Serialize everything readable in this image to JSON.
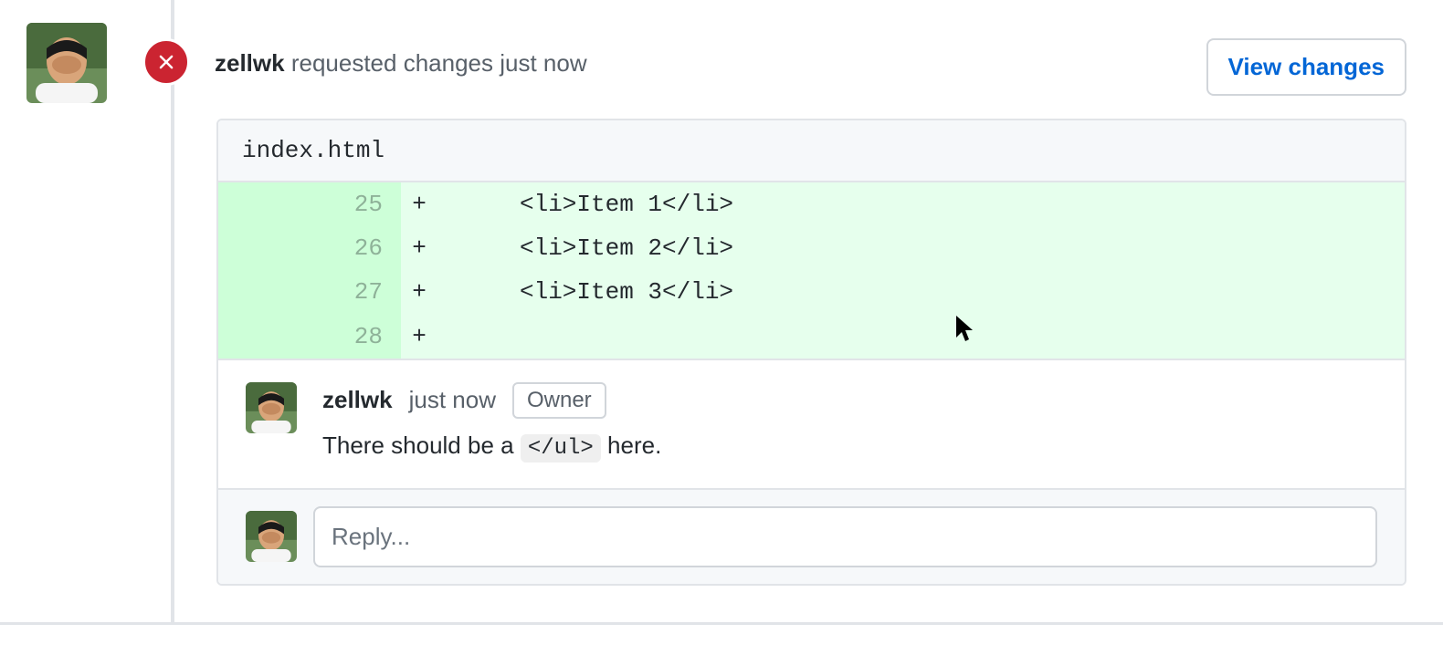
{
  "review": {
    "author": "zellwk",
    "action": "requested changes",
    "time": "just now",
    "view_changes_label": "View changes",
    "status": "changes_requested"
  },
  "file": {
    "name": "index.html"
  },
  "diff": {
    "lines": [
      {
        "new_no": "25",
        "old_no": "",
        "marker": "+",
        "code": "<li>Item 1</li>"
      },
      {
        "new_no": "26",
        "old_no": "",
        "marker": "+",
        "code": "<li>Item 2</li>"
      },
      {
        "new_no": "27",
        "old_no": "",
        "marker": "+",
        "code": "<li>Item 3</li>"
      },
      {
        "new_no": "28",
        "old_no": "",
        "marker": "+",
        "code": ""
      }
    ]
  },
  "comment": {
    "author": "zellwk",
    "time": "just now",
    "badge": "Owner",
    "text_before": "There should be a ",
    "code": "</ul>",
    "text_after": " here."
  },
  "reply": {
    "placeholder": "Reply..."
  },
  "colors": {
    "danger": "#cb2431",
    "link": "#0366d6",
    "diff_add_bg": "#e6ffed",
    "diff_add_ln_bg": "#cdffd8"
  }
}
